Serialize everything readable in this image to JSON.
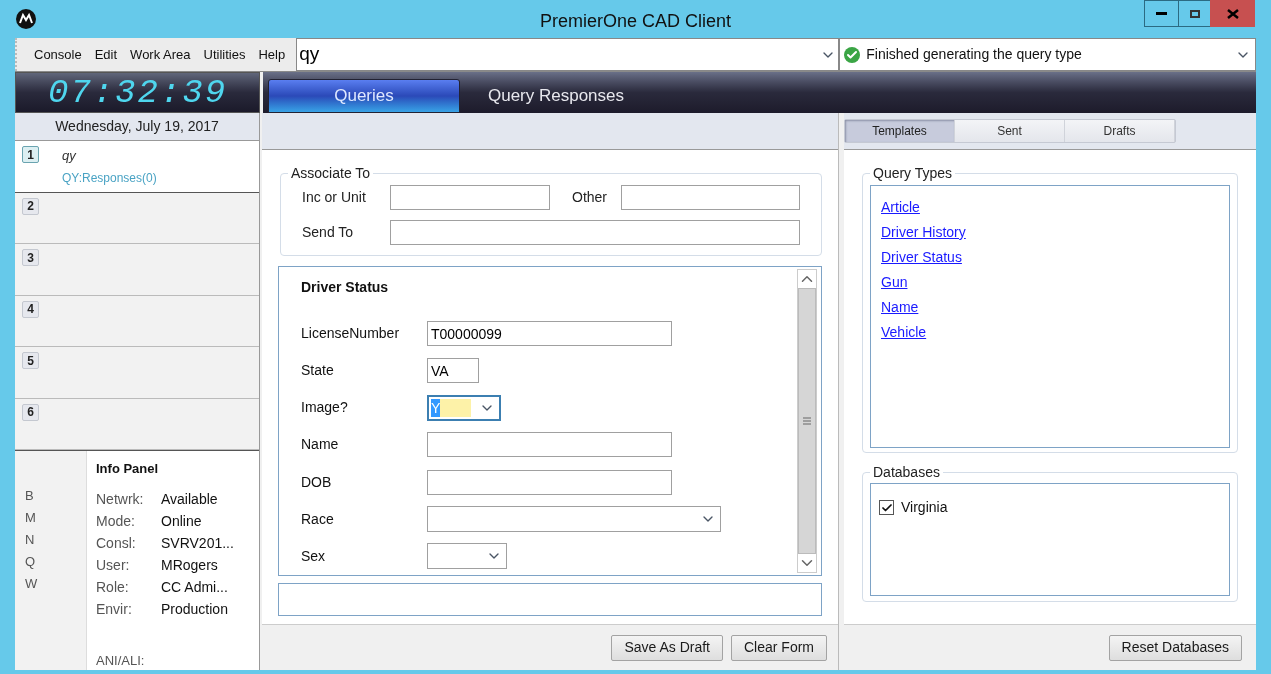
{
  "window": {
    "title": "PremierOne CAD Client"
  },
  "menu": [
    "Console",
    "Edit",
    "Work Area",
    "Utilities",
    "Help"
  ],
  "command_field": {
    "value": "qy"
  },
  "status_field": {
    "value": "Finished generating the query type"
  },
  "clock": "07:32:39",
  "date": "Wednesday, July 19, 2017",
  "main_tabs": [
    {
      "label": "Queries",
      "selected": true
    },
    {
      "label": "Query Responses",
      "selected": false
    }
  ],
  "slots": [
    {
      "number": "1",
      "title": "qy",
      "subtitle": "QY:Responses(0)",
      "selected": true
    },
    {
      "number": "2",
      "selected": false
    },
    {
      "number": "3",
      "selected": false
    },
    {
      "number": "4",
      "selected": false
    },
    {
      "number": "5",
      "selected": false
    },
    {
      "number": "6",
      "selected": false
    }
  ],
  "info_panel": {
    "title": "Info Panel",
    "shortcuts": [
      "B",
      "M",
      "N",
      "Q",
      "W"
    ],
    "rows": [
      {
        "label": "Netwrk:",
        "value": "Available"
      },
      {
        "label": "Mode:",
        "value": "Online"
      },
      {
        "label": "Consl:",
        "value": "SVRV201..."
      },
      {
        "label": "User:",
        "value": "MRogers"
      },
      {
        "label": "Role:",
        "value": "CC Admi..."
      },
      {
        "label": "Envir:",
        "value": "Production"
      }
    ],
    "footer": "ANI/ALI:"
  },
  "associate_to": {
    "legend": "Associate To",
    "fields": [
      {
        "label": "Inc or Unit"
      },
      {
        "label": "Other"
      },
      {
        "label": "Send To"
      }
    ]
  },
  "query_form": {
    "title": "Driver Status",
    "fields": [
      {
        "label": "LicenseNumber",
        "kind": "text",
        "value": "T00000099",
        "focused": false
      },
      {
        "label": "State",
        "kind": "text",
        "value": "VA",
        "focused": false
      },
      {
        "label": "Image?",
        "kind": "select",
        "value": "Y",
        "focused": true
      },
      {
        "label": "Name",
        "kind": "text",
        "focused": false
      },
      {
        "label": "DOB",
        "kind": "text",
        "focused": false
      },
      {
        "label": "Race",
        "kind": "select",
        "focused": false
      },
      {
        "label": "Sex",
        "kind": "select",
        "focused": false
      }
    ]
  },
  "form_buttons": [
    "Save As Draft",
    "Clear Form"
  ],
  "right_tabs": [
    {
      "label": "Templates",
      "selected": true
    },
    {
      "label": "Sent",
      "selected": false
    },
    {
      "label": "Drafts",
      "selected": false
    }
  ],
  "query_types": {
    "legend": "Query Types",
    "items": [
      "Article",
      "Driver History",
      "Driver Status",
      "Gun",
      "Name",
      "Vehicle"
    ]
  },
  "databases": {
    "legend": "Databases",
    "items": [
      {
        "label": "Virginia",
        "checked": true
      }
    ]
  },
  "reset_button": "Reset Databases"
}
